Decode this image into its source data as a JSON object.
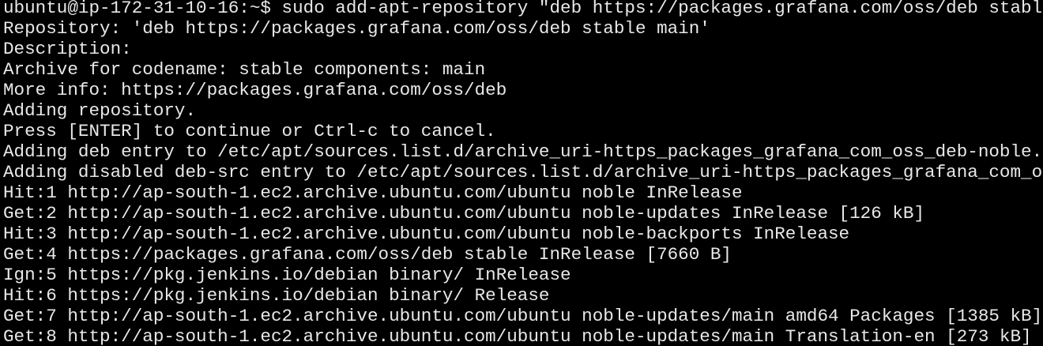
{
  "terminal": {
    "colors": {
      "background": "#000000",
      "foreground": "#e8e8e8"
    },
    "lines": [
      "ubuntu@ip-172-31-10-16:~$ sudo add-apt-repository \"deb https://packages.grafana.com/oss/deb stable",
      "Repository: 'deb https://packages.grafana.com/oss/deb stable main'",
      "Description:",
      "Archive for codename: stable components: main",
      "More info: https://packages.grafana.com/oss/deb",
      "Adding repository.",
      "Press [ENTER] to continue or Ctrl-c to cancel.",
      "Adding deb entry to /etc/apt/sources.list.d/archive_uri-https_packages_grafana_com_oss_deb-noble.l",
      "Adding disabled deb-src entry to /etc/apt/sources.list.d/archive_uri-https_packages_grafana_com_os",
      "Hit:1 http://ap-south-1.ec2.archive.ubuntu.com/ubuntu noble InRelease",
      "Get:2 http://ap-south-1.ec2.archive.ubuntu.com/ubuntu noble-updates InRelease [126 kB]",
      "Hit:3 http://ap-south-1.ec2.archive.ubuntu.com/ubuntu noble-backports InRelease",
      "Get:4 https://packages.grafana.com/oss/deb stable InRelease [7660 B]",
      "Ign:5 https://pkg.jenkins.io/debian binary/ InRelease",
      "Hit:6 https://pkg.jenkins.io/debian binary/ Release",
      "Get:7 http://ap-south-1.ec2.archive.ubuntu.com/ubuntu noble-updates/main amd64 Packages [1385 kB]",
      "Get:8 http://ap-south-1.ec2.archive.ubuntu.com/ubuntu noble-updates/main Translation-en [273 kB]"
    ]
  }
}
